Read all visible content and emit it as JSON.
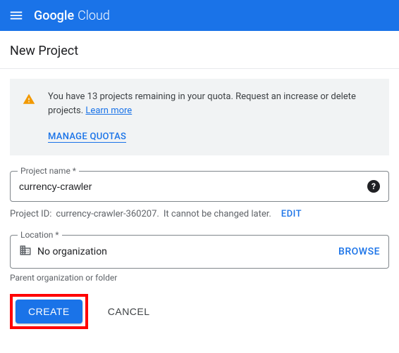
{
  "header": {
    "logo_google": "Google",
    "logo_cloud": "Cloud"
  },
  "page": {
    "title": "New Project"
  },
  "quota": {
    "message": "You have 13 projects remaining in your quota. Request an increase or delete projects. ",
    "learn_more": "Learn more",
    "manage": "MANAGE QUOTAS"
  },
  "project_name": {
    "label": "Project name *",
    "value": "currency-crawler"
  },
  "project_id": {
    "prefix": "Project ID:",
    "value": "currency-crawler-360207.",
    "note": "It cannot be changed later.",
    "edit": "EDIT"
  },
  "location": {
    "label": "Location *",
    "value": "No organization",
    "browse": "BROWSE",
    "helper": "Parent organization or folder"
  },
  "actions": {
    "create": "CREATE",
    "cancel": "CANCEL"
  }
}
